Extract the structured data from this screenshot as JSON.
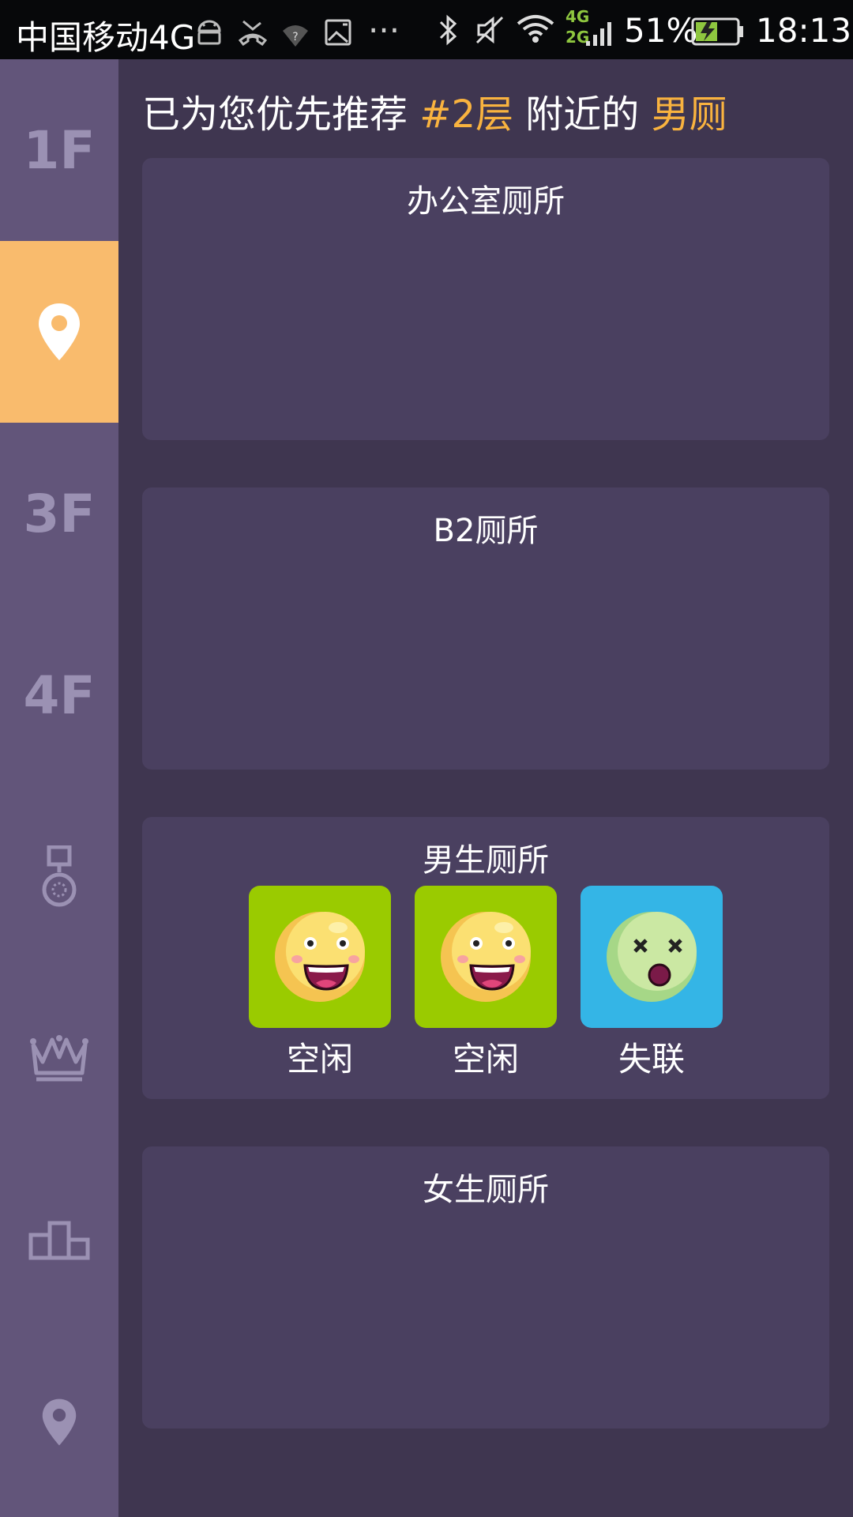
{
  "status_bar": {
    "carrier": "中国移动4G",
    "battery_percent": "51%",
    "time": "18:13",
    "network_badges": [
      "4G",
      "2G"
    ],
    "icons": [
      "android-icon",
      "missed-call-icon",
      "wifi-question-icon",
      "image-icon",
      "more-icon",
      "bluetooth-icon",
      "mute-icon",
      "wifi-icon",
      "signal-icon",
      "battery-charging-icon"
    ]
  },
  "sidebar": {
    "items": [
      {
        "label": "1F",
        "icon": null,
        "active": false
      },
      {
        "label": "",
        "icon": "location-pin-icon",
        "active": true
      },
      {
        "label": "3F",
        "icon": null,
        "active": false
      },
      {
        "label": "4F",
        "icon": null,
        "active": false
      },
      {
        "label": "",
        "icon": "medal-icon",
        "active": false
      },
      {
        "label": "",
        "icon": "crown-icon",
        "active": false
      },
      {
        "label": "",
        "icon": "podium-icon",
        "active": false
      },
      {
        "label": "",
        "icon": "location-pin-icon",
        "active": false
      }
    ],
    "colors": {
      "background": "#62557a",
      "active": "#f9bb6d",
      "icon": "#9b91b3"
    }
  },
  "headline": {
    "prefix": "已为您优先推荐 ",
    "floor": "#2层",
    "middle": " 附近的 ",
    "type": "男厕",
    "highlight_color": "#f9b33f"
  },
  "cards": [
    {
      "title": "办公室厕所",
      "stalls": []
    },
    {
      "title": "B2厕所",
      "stalls": []
    },
    {
      "title": "男生厕所",
      "stalls": [
        {
          "status": "空闲",
          "face": "happy-face-icon",
          "color": "#9acb00"
        },
        {
          "status": "空闲",
          "face": "happy-face-icon",
          "color": "#9acb00"
        },
        {
          "status": "失联",
          "face": "dizzy-face-icon",
          "color": "#34b5e6"
        }
      ]
    },
    {
      "title": "女生厕所",
      "stalls": []
    }
  ]
}
